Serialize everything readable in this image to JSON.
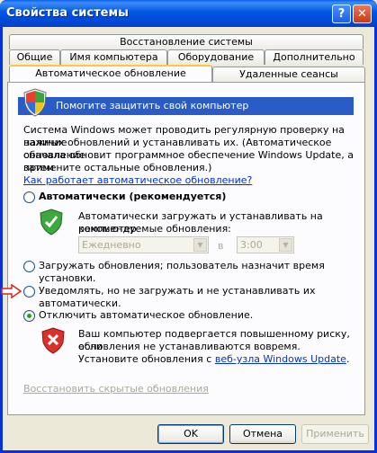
{
  "window": {
    "title": "Свойства системы",
    "help_button": "?",
    "close_button": "✕"
  },
  "tabs": {
    "row1": [
      "Восстановление системы"
    ],
    "row2": [
      "Общие",
      "Имя компьютера",
      "Оборудование",
      "Дополнительно"
    ],
    "row3": [
      "Автоматическое обновление",
      "Удаленные сеансы"
    ],
    "active": "Автоматическое обновление"
  },
  "banner": {
    "text": "Помогите защитить свой компьютер"
  },
  "intro": {
    "line1": "Система Windows может проводить регулярную проверку на наличие",
    "line2": "важных обновлений и устанавливать их. (Автоматическое обновление",
    "line3": "сначала обновит программное обеспечение Windows Update, а затем",
    "line4": "примените остальные обновления.)",
    "link": "Как работает автоматическое обновление?"
  },
  "options": {
    "automatic": {
      "label": "Автоматически (рекомендуется)",
      "desc1": "Автоматически загружать и устанавливать на компьютер",
      "desc2": "рекомендуемые обновления:",
      "schedule_day": "Ежедневно",
      "schedule_at": "в",
      "schedule_time": "3:00"
    },
    "download": {
      "label": "Загружать обновления; пользователь назначит время установки."
    },
    "notify": {
      "label": "Уведомлять, но не загружать и не устанавливать их автоматически."
    },
    "off": {
      "label": "Отключить автоматическое обновление.",
      "desc1": "Ваш компьютер подвергается повышенному риску, если",
      "desc2": "обновления не устанавливаются вовремя.",
      "desc3_prefix": "Установите обновления с",
      "desc3_link": "веб-узла Windows Update",
      "desc3_suffix": "."
    },
    "selected": "off"
  },
  "restore_hidden_link": "Восстановить скрытые обновления",
  "buttons": {
    "ok": "OK",
    "cancel": "Отмена",
    "apply": "Применить"
  },
  "colors": {
    "titlebar": "#0055e5",
    "banner": "#2a5cc7",
    "link": "#0033cc",
    "annotation_arrow": "#e0201b"
  }
}
